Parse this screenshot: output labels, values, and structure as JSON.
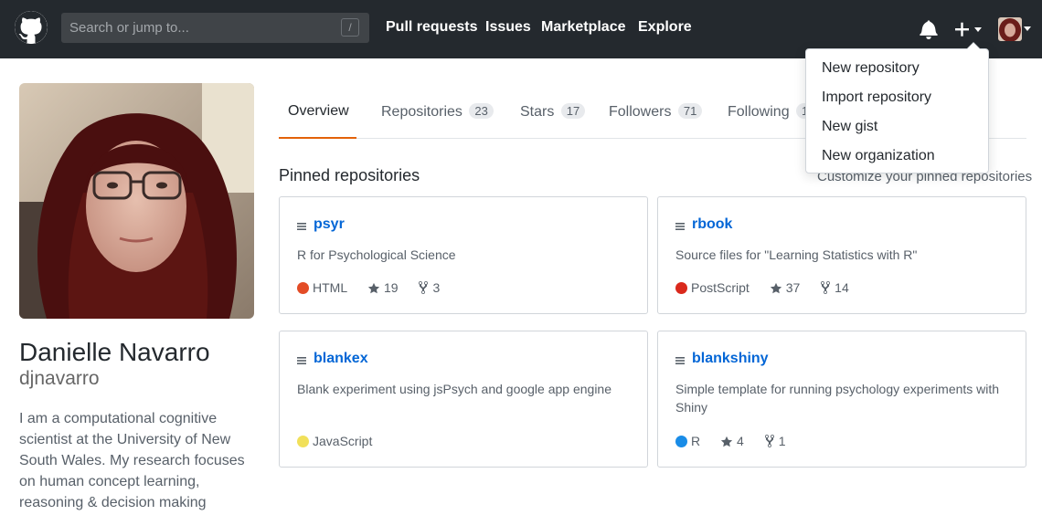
{
  "header": {
    "search_placeholder": "Search or jump to...",
    "search_shortcut": "/",
    "nav": [
      "Pull requests",
      "Issues",
      "Marketplace",
      "Explore"
    ]
  },
  "dropdown": {
    "items": [
      "New repository",
      "Import repository",
      "New gist",
      "New organization"
    ]
  },
  "profile": {
    "full_name": "Danielle Navarro",
    "login": "djnavarro",
    "bio": "I am a computational cognitive scientist at the University of New South Wales. My research focuses on human concept learning, reasoning & decision making"
  },
  "tabs": [
    {
      "label": "Overview",
      "count": ""
    },
    {
      "label": "Repositories",
      "count": "23"
    },
    {
      "label": "Stars",
      "count": "17"
    },
    {
      "label": "Followers",
      "count": "71"
    },
    {
      "label": "Following",
      "count": "12"
    }
  ],
  "pinned": {
    "title": "Pinned repositories",
    "customize": "Customize your pinned repositories",
    "repos": [
      {
        "name": "psyr",
        "description": "R for Psychological Science",
        "language": "HTML",
        "language_color": "#e34c26",
        "stars": "19",
        "forks": "3"
      },
      {
        "name": "rbook",
        "description": "Source files for \"Learning Statistics with R\"",
        "language": "PostScript",
        "language_color": "#da291c",
        "stars": "37",
        "forks": "14"
      },
      {
        "name": "blankex",
        "description": "Blank experiment using jsPsych and google app engine",
        "language": "JavaScript",
        "language_color": "#f1e05a",
        "stars": "",
        "forks": ""
      },
      {
        "name": "blankshiny",
        "description": "Simple template for running psychology experiments with Shiny",
        "language": "R",
        "language_color": "#198ce7",
        "stars": "4",
        "forks": "1"
      }
    ]
  },
  "colors": {
    "header_bg": "#24292e",
    "link": "#0366d6",
    "tab_underline": "#e36209"
  }
}
